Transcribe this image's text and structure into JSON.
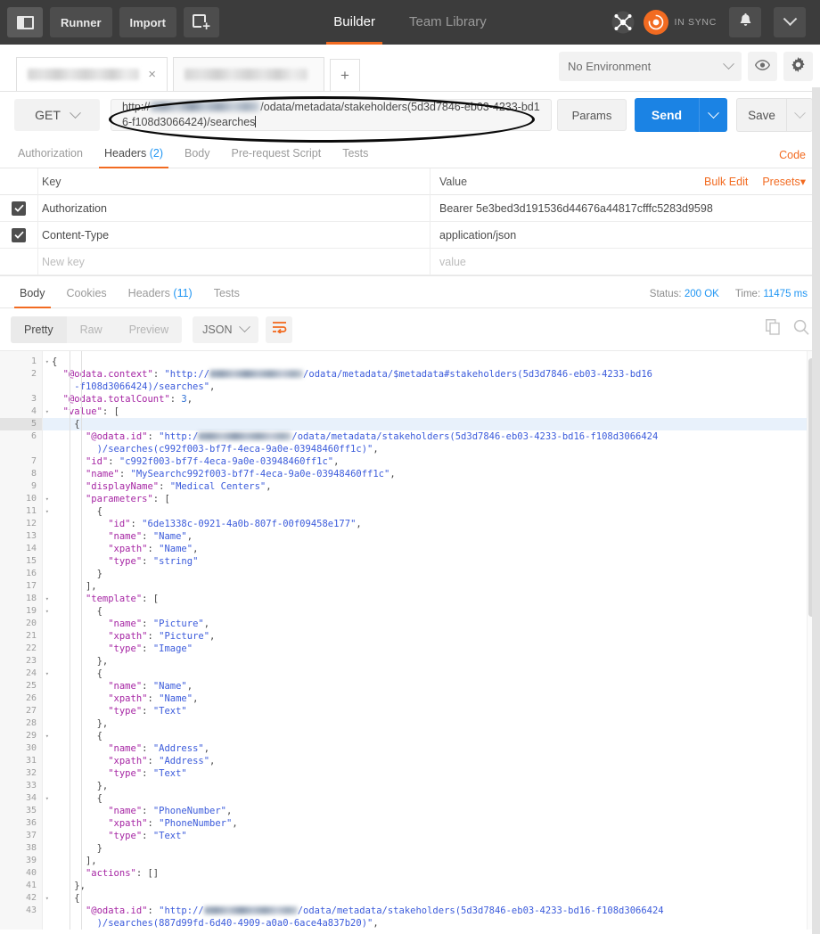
{
  "topbar": {
    "sidebar_toggle": "sidebar-toggle",
    "runner_label": "Runner",
    "import_label": "Import",
    "new_tab_label": "new-request",
    "tabs": [
      {
        "label": "Builder",
        "selected": true
      },
      {
        "label": "Team Library",
        "selected": false
      }
    ],
    "sync_label": "IN SYNC",
    "accent_orange": "#f26b21",
    "bar_bg": "#3c3c3c"
  },
  "tabstrip": {
    "tabs": [
      {
        "label": "",
        "redacted": true,
        "active": true,
        "close": "×"
      },
      {
        "label": "",
        "redacted": true,
        "active": false
      }
    ],
    "add_tab_label": "+",
    "environment": {
      "selected": "No Environment",
      "eye_icon": "eye-icon",
      "gear_icon": "gear-icon"
    }
  },
  "request": {
    "method": "GET",
    "url_prefix": "http://",
    "url_host_redacted": true,
    "url_suffix": "/odata/metadata/stakeholders(5d3d7846-eb03-4233-bd16-f108d3066424)/searches",
    "params_label": "Params",
    "send_label": "Send",
    "save_label": "Save",
    "send_color": "#1b83e4",
    "tabs": [
      {
        "label": "Authorization",
        "count": "",
        "selected": false
      },
      {
        "label": "Headers",
        "count": "(2)",
        "selected": true
      },
      {
        "label": "Body",
        "count": "",
        "selected": false
      },
      {
        "label": "Pre-request Script",
        "count": "",
        "selected": false
      },
      {
        "label": "Tests",
        "count": "",
        "selected": false
      }
    ],
    "code_link": "Code"
  },
  "headers_table": {
    "col_key": "Key",
    "col_value": "Value",
    "bulk_edit": "Bulk Edit",
    "presets": "Presets",
    "presets_caret": "▾",
    "rows": [
      {
        "checked": true,
        "key": "Authorization",
        "value": "Bearer 5e3bed3d191536d44676a44817cfffc5283d9598"
      },
      {
        "checked": true,
        "key": "Content-Type",
        "value": "application/json"
      }
    ],
    "new_row": {
      "key_placeholder": "New key",
      "value_placeholder": "value"
    }
  },
  "response": {
    "tabs": [
      {
        "label": "Body",
        "count": "",
        "selected": true
      },
      {
        "label": "Cookies",
        "count": "",
        "selected": false
      },
      {
        "label": "Headers",
        "count": "(11)",
        "selected": false
      },
      {
        "label": "Tests",
        "count": "",
        "selected": false
      }
    ],
    "status_label": "Status:",
    "status_value": "200 OK",
    "time_label": "Time:",
    "time_value": "11475 ms",
    "view_modes": [
      {
        "label": "Pretty",
        "selected": true
      },
      {
        "label": "Raw",
        "selected": false
      },
      {
        "label": "Preview",
        "selected": false
      }
    ],
    "format": "JSON",
    "wrap_icon": "wrap-text-icon",
    "copy_icon": "copy-icon",
    "search_icon": "search-icon"
  },
  "code": {
    "highlight_line": 5,
    "lines": [
      {
        "n": 1,
        "fold": true,
        "indent": 0,
        "tokens": [
          {
            "t": "p",
            "v": "{"
          }
        ]
      },
      {
        "n": 2,
        "fold": false,
        "indent": 1,
        "tokens": [
          {
            "t": "k",
            "v": "\"@odata.context\""
          },
          {
            "t": "p",
            "v": ": "
          },
          {
            "t": "s",
            "v": "\"http://"
          },
          {
            "t": "blur",
            "v": ""
          },
          {
            "t": "s",
            "v": "/odata/metadata/$metadata#stakeholders(5d3d7846-eb03-4233-bd16"
          }
        ]
      },
      {
        "n": null,
        "cont": true,
        "indent": 2,
        "tokens": [
          {
            "t": "s",
            "v": "-f108d3066424)/searches\""
          },
          {
            "t": "p",
            "v": ","
          }
        ]
      },
      {
        "n": 3,
        "fold": false,
        "indent": 1,
        "tokens": [
          {
            "t": "k",
            "v": "\"@odata.totalCount\""
          },
          {
            "t": "p",
            "v": ": "
          },
          {
            "t": "n",
            "v": "3"
          },
          {
            "t": "p",
            "v": ","
          }
        ]
      },
      {
        "n": 4,
        "fold": true,
        "indent": 1,
        "tokens": [
          {
            "t": "k",
            "v": "\"value\""
          },
          {
            "t": "p",
            "v": ": ["
          }
        ]
      },
      {
        "n": 5,
        "fold": true,
        "indent": 2,
        "tokens": [
          {
            "t": "p",
            "v": "{"
          }
        ]
      },
      {
        "n": 6,
        "fold": false,
        "indent": 3,
        "tokens": [
          {
            "t": "k",
            "v": "\"@odata.id\""
          },
          {
            "t": "p",
            "v": ": "
          },
          {
            "t": "s",
            "v": "\"http:/"
          },
          {
            "t": "blur",
            "v": ""
          },
          {
            "t": "s",
            "v": "/odata/metadata/stakeholders(5d3d7846-eb03-4233-bd16-f108d3066424"
          }
        ]
      },
      {
        "n": null,
        "cont": true,
        "indent": 4,
        "tokens": [
          {
            "t": "s",
            "v": ")/searches(c992f003-bf7f-4eca-9a0e-03948460ff1c)\""
          },
          {
            "t": "p",
            "v": ","
          }
        ]
      },
      {
        "n": 7,
        "fold": false,
        "indent": 3,
        "tokens": [
          {
            "t": "k",
            "v": "\"id\""
          },
          {
            "t": "p",
            "v": ": "
          },
          {
            "t": "s",
            "v": "\"c992f003-bf7f-4eca-9a0e-03948460ff1c\""
          },
          {
            "t": "p",
            "v": ","
          }
        ]
      },
      {
        "n": 8,
        "fold": false,
        "indent": 3,
        "tokens": [
          {
            "t": "k",
            "v": "\"name\""
          },
          {
            "t": "p",
            "v": ": "
          },
          {
            "t": "s",
            "v": "\"MySearchc992f003-bf7f-4eca-9a0e-03948460ff1c\""
          },
          {
            "t": "p",
            "v": ","
          }
        ]
      },
      {
        "n": 9,
        "fold": false,
        "indent": 3,
        "tokens": [
          {
            "t": "k",
            "v": "\"displayName\""
          },
          {
            "t": "p",
            "v": ": "
          },
          {
            "t": "s",
            "v": "\"Medical Centers\""
          },
          {
            "t": "p",
            "v": ","
          }
        ]
      },
      {
        "n": 10,
        "fold": true,
        "indent": 3,
        "tokens": [
          {
            "t": "k",
            "v": "\"parameters\""
          },
          {
            "t": "p",
            "v": ": ["
          }
        ]
      },
      {
        "n": 11,
        "fold": true,
        "indent": 4,
        "tokens": [
          {
            "t": "p",
            "v": "{"
          }
        ]
      },
      {
        "n": 12,
        "fold": false,
        "indent": 5,
        "tokens": [
          {
            "t": "k",
            "v": "\"id\""
          },
          {
            "t": "p",
            "v": ": "
          },
          {
            "t": "s",
            "v": "\"6de1338c-0921-4a0b-807f-00f09458e177\""
          },
          {
            "t": "p",
            "v": ","
          }
        ]
      },
      {
        "n": 13,
        "fold": false,
        "indent": 5,
        "tokens": [
          {
            "t": "k",
            "v": "\"name\""
          },
          {
            "t": "p",
            "v": ": "
          },
          {
            "t": "s",
            "v": "\"Name\""
          },
          {
            "t": "p",
            "v": ","
          }
        ]
      },
      {
        "n": 14,
        "fold": false,
        "indent": 5,
        "tokens": [
          {
            "t": "k",
            "v": "\"xpath\""
          },
          {
            "t": "p",
            "v": ": "
          },
          {
            "t": "s",
            "v": "\"Name\""
          },
          {
            "t": "p",
            "v": ","
          }
        ]
      },
      {
        "n": 15,
        "fold": false,
        "indent": 5,
        "tokens": [
          {
            "t": "k",
            "v": "\"type\""
          },
          {
            "t": "p",
            "v": ": "
          },
          {
            "t": "s",
            "v": "\"string\""
          }
        ]
      },
      {
        "n": 16,
        "fold": false,
        "indent": 4,
        "tokens": [
          {
            "t": "p",
            "v": "}"
          }
        ]
      },
      {
        "n": 17,
        "fold": false,
        "indent": 3,
        "tokens": [
          {
            "t": "p",
            "v": "],"
          }
        ]
      },
      {
        "n": 18,
        "fold": true,
        "indent": 3,
        "tokens": [
          {
            "t": "k",
            "v": "\"template\""
          },
          {
            "t": "p",
            "v": ": ["
          }
        ]
      },
      {
        "n": 19,
        "fold": true,
        "indent": 4,
        "tokens": [
          {
            "t": "p",
            "v": "{"
          }
        ]
      },
      {
        "n": 20,
        "fold": false,
        "indent": 5,
        "tokens": [
          {
            "t": "k",
            "v": "\"name\""
          },
          {
            "t": "p",
            "v": ": "
          },
          {
            "t": "s",
            "v": "\"Picture\""
          },
          {
            "t": "p",
            "v": ","
          }
        ]
      },
      {
        "n": 21,
        "fold": false,
        "indent": 5,
        "tokens": [
          {
            "t": "k",
            "v": "\"xpath\""
          },
          {
            "t": "p",
            "v": ": "
          },
          {
            "t": "s",
            "v": "\"Picture\""
          },
          {
            "t": "p",
            "v": ","
          }
        ]
      },
      {
        "n": 22,
        "fold": false,
        "indent": 5,
        "tokens": [
          {
            "t": "k",
            "v": "\"type\""
          },
          {
            "t": "p",
            "v": ": "
          },
          {
            "t": "s",
            "v": "\"Image\""
          }
        ]
      },
      {
        "n": 23,
        "fold": false,
        "indent": 4,
        "tokens": [
          {
            "t": "p",
            "v": "},"
          }
        ]
      },
      {
        "n": 24,
        "fold": true,
        "indent": 4,
        "tokens": [
          {
            "t": "p",
            "v": "{"
          }
        ]
      },
      {
        "n": 25,
        "fold": false,
        "indent": 5,
        "tokens": [
          {
            "t": "k",
            "v": "\"name\""
          },
          {
            "t": "p",
            "v": ": "
          },
          {
            "t": "s",
            "v": "\"Name\""
          },
          {
            "t": "p",
            "v": ","
          }
        ]
      },
      {
        "n": 26,
        "fold": false,
        "indent": 5,
        "tokens": [
          {
            "t": "k",
            "v": "\"xpath\""
          },
          {
            "t": "p",
            "v": ": "
          },
          {
            "t": "s",
            "v": "\"Name\""
          },
          {
            "t": "p",
            "v": ","
          }
        ]
      },
      {
        "n": 27,
        "fold": false,
        "indent": 5,
        "tokens": [
          {
            "t": "k",
            "v": "\"type\""
          },
          {
            "t": "p",
            "v": ": "
          },
          {
            "t": "s",
            "v": "\"Text\""
          }
        ]
      },
      {
        "n": 28,
        "fold": false,
        "indent": 4,
        "tokens": [
          {
            "t": "p",
            "v": "},"
          }
        ]
      },
      {
        "n": 29,
        "fold": true,
        "indent": 4,
        "tokens": [
          {
            "t": "p",
            "v": "{"
          }
        ]
      },
      {
        "n": 30,
        "fold": false,
        "indent": 5,
        "tokens": [
          {
            "t": "k",
            "v": "\"name\""
          },
          {
            "t": "p",
            "v": ": "
          },
          {
            "t": "s",
            "v": "\"Address\""
          },
          {
            "t": "p",
            "v": ","
          }
        ]
      },
      {
        "n": 31,
        "fold": false,
        "indent": 5,
        "tokens": [
          {
            "t": "k",
            "v": "\"xpath\""
          },
          {
            "t": "p",
            "v": ": "
          },
          {
            "t": "s",
            "v": "\"Address\""
          },
          {
            "t": "p",
            "v": ","
          }
        ]
      },
      {
        "n": 32,
        "fold": false,
        "indent": 5,
        "tokens": [
          {
            "t": "k",
            "v": "\"type\""
          },
          {
            "t": "p",
            "v": ": "
          },
          {
            "t": "s",
            "v": "\"Text\""
          }
        ]
      },
      {
        "n": 33,
        "fold": false,
        "indent": 4,
        "tokens": [
          {
            "t": "p",
            "v": "},"
          }
        ]
      },
      {
        "n": 34,
        "fold": true,
        "indent": 4,
        "tokens": [
          {
            "t": "p",
            "v": "{"
          }
        ]
      },
      {
        "n": 35,
        "fold": false,
        "indent": 5,
        "tokens": [
          {
            "t": "k",
            "v": "\"name\""
          },
          {
            "t": "p",
            "v": ": "
          },
          {
            "t": "s",
            "v": "\"PhoneNumber\""
          },
          {
            "t": "p",
            "v": ","
          }
        ]
      },
      {
        "n": 36,
        "fold": false,
        "indent": 5,
        "tokens": [
          {
            "t": "k",
            "v": "\"xpath\""
          },
          {
            "t": "p",
            "v": ": "
          },
          {
            "t": "s",
            "v": "\"PhoneNumber\""
          },
          {
            "t": "p",
            "v": ","
          }
        ]
      },
      {
        "n": 37,
        "fold": false,
        "indent": 5,
        "tokens": [
          {
            "t": "k",
            "v": "\"type\""
          },
          {
            "t": "p",
            "v": ": "
          },
          {
            "t": "s",
            "v": "\"Text\""
          }
        ]
      },
      {
        "n": 38,
        "fold": false,
        "indent": 4,
        "tokens": [
          {
            "t": "p",
            "v": "}"
          }
        ]
      },
      {
        "n": 39,
        "fold": false,
        "indent": 3,
        "tokens": [
          {
            "t": "p",
            "v": "],"
          }
        ]
      },
      {
        "n": 40,
        "fold": false,
        "indent": 3,
        "tokens": [
          {
            "t": "k",
            "v": "\"actions\""
          },
          {
            "t": "p",
            "v": ": []"
          }
        ]
      },
      {
        "n": 41,
        "fold": false,
        "indent": 2,
        "tokens": [
          {
            "t": "p",
            "v": "},"
          }
        ]
      },
      {
        "n": 42,
        "fold": true,
        "indent": 2,
        "tokens": [
          {
            "t": "p",
            "v": "{"
          }
        ]
      },
      {
        "n": 43,
        "fold": false,
        "indent": 3,
        "tokens": [
          {
            "t": "k",
            "v": "\"@odata.id\""
          },
          {
            "t": "p",
            "v": ": "
          },
          {
            "t": "s",
            "v": "\"http://"
          },
          {
            "t": "blur",
            "v": ""
          },
          {
            "t": "s",
            "v": "/odata/metadata/stakeholders(5d3d7846-eb03-4233-bd16-f108d3066424"
          }
        ]
      },
      {
        "n": null,
        "cont": true,
        "indent": 4,
        "tokens": [
          {
            "t": "s",
            "v": ")/searches(887d99fd-6d40-4909-a0a0-6ace4a837b20)\""
          },
          {
            "t": "p",
            "v": ","
          }
        ]
      }
    ]
  }
}
